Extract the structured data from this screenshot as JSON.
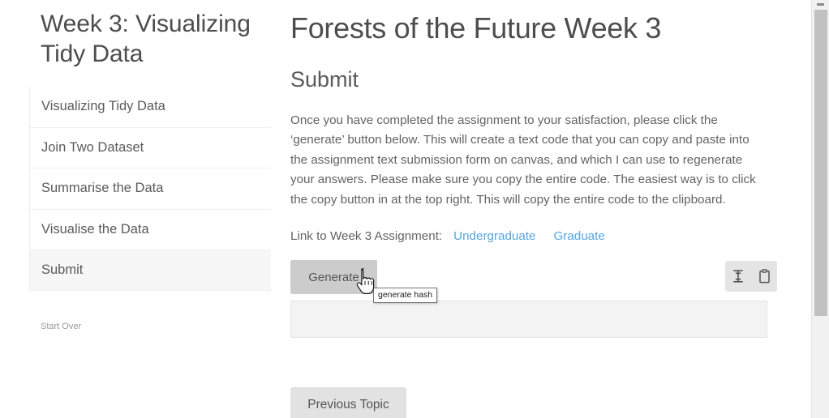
{
  "sidebar": {
    "title": "Week 3: Visualizing Tidy Data",
    "items": [
      {
        "label": "Visualizing Tidy Data",
        "active": false
      },
      {
        "label": "Join Two Dataset",
        "active": false
      },
      {
        "label": "Summarise the Data",
        "active": false
      },
      {
        "label": "Visualise the Data",
        "active": false
      },
      {
        "label": "Submit",
        "active": true
      }
    ],
    "start_over": "Start Over"
  },
  "main": {
    "page_title": "Forests of the Future Week 3",
    "section_title": "Submit",
    "intro_paragraph": "Once you have completed the assignment to your satisfaction, please click the ‘generate’ button below. This will create a text code that you can copy and paste into the assignment text submission form on canvas, and which I can use to regenerate your answers. Please make sure you copy the entire code. The easiest way is to click the copy button in at the top right. This will copy the entire code to the clipboard.",
    "link_row": {
      "label": "Link to Week 3 Assignment:",
      "links": [
        {
          "label": "Undergraduate"
        },
        {
          "label": "Graduate"
        }
      ]
    },
    "generate_button": "Generate",
    "tooltip": "generate hash",
    "icons": [
      {
        "name": "text-select-icon",
        "title": "select all"
      },
      {
        "name": "clipboard-copy-icon",
        "title": "copy to clipboard"
      }
    ],
    "hash_output": {
      "value": "",
      "placeholder": ""
    },
    "previous_topic_button": "Previous Topic"
  },
  "scrollbar": {
    "position_percent": 0
  },
  "colors": {
    "link": "#55a5e0",
    "generate_button_bg": "#cccccc",
    "previous_button_bg": "#e2e2e2",
    "icon_group_bg": "#e4e4e4",
    "output_bg": "#f3f3f3",
    "active_nav_bg": "#f7f7f7",
    "text": "#636363",
    "heading": "#4d4d4d"
  }
}
